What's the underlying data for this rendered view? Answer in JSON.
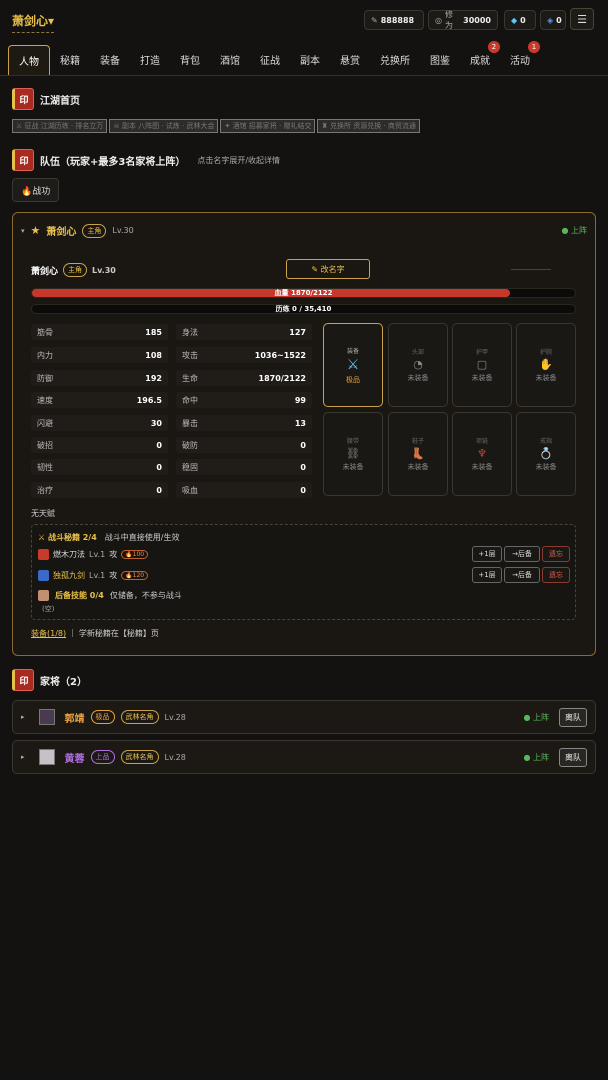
{
  "header": {
    "char_name": "萧剑心▾",
    "currency": {
      "icon": "coin-icon",
      "value": "888888"
    },
    "cultivation": {
      "label": "修为",
      "value": "30000"
    },
    "diamond": {
      "value": "0"
    },
    "gem": {
      "value": "0"
    },
    "menu_icon": "☰"
  },
  "tabs": [
    {
      "label": "人物",
      "active": true
    },
    {
      "label": "秘籍"
    },
    {
      "label": "装备"
    },
    {
      "label": "打造"
    },
    {
      "label": "背包"
    },
    {
      "label": "酒馆"
    },
    {
      "label": "征战"
    },
    {
      "label": "副本"
    },
    {
      "label": "悬赏"
    },
    {
      "label": "兑换所"
    },
    {
      "label": "图鉴"
    },
    {
      "label": "成就",
      "badge": "2"
    },
    {
      "label": "活动",
      "badge": "1"
    }
  ],
  "home": {
    "seal": "印",
    "title": "江湖首页",
    "links": [
      "⚔ 征战 江湖历练 · 排名立万",
      "☠ 副本 八阵图 · 试炼 · 武林大会",
      "✦ 酒馆 招募家将 · 赠礼结交",
      "♜ 兑换所 资源兑换 · 商贸流通"
    ]
  },
  "team": {
    "seal": "印",
    "title": "队伍（玩家+最多3名家将上阵）",
    "hint": "点击名字展开/收起详情",
    "battle_power": "🔥战功"
  },
  "hero": {
    "star": "★",
    "name": "萧剑心",
    "role": "主角",
    "level": "Lv.30",
    "status": "● 上阵",
    "rename": "✎ 改名字",
    "hp_label": "血量 1870/2122",
    "hp_fraction": 0.881,
    "exp_label": "历练 0 / 35,410",
    "exp_fraction": 0,
    "stats_left": [
      {
        "k": "筋骨",
        "v": "185"
      },
      {
        "k": "内力",
        "v": "108"
      },
      {
        "k": "防御",
        "v": "192"
      },
      {
        "k": "速度",
        "v": "196.5"
      },
      {
        "k": "闪避",
        "v": "30"
      },
      {
        "k": "破招",
        "v": "0"
      },
      {
        "k": "韧性",
        "v": "0"
      },
      {
        "k": "治疗",
        "v": "0"
      }
    ],
    "stats_right": [
      {
        "k": "身法",
        "v": "127"
      },
      {
        "k": "攻击",
        "v": "1036~1522"
      },
      {
        "k": "生命",
        "v": "1870/2122"
      },
      {
        "k": "命中",
        "v": "99"
      },
      {
        "k": "暴击",
        "v": "13"
      },
      {
        "k": "破防",
        "v": "0"
      },
      {
        "k": "稳固",
        "v": "0"
      },
      {
        "k": "吸血",
        "v": "0"
      }
    ],
    "slots": [
      {
        "label": "装备",
        "icon": "⚔",
        "text": "极品",
        "equipped": true
      },
      {
        "label": "头部",
        "icon": "◔",
        "text": "未装备"
      },
      {
        "label": "护甲",
        "icon": "▢",
        "text": "未装备"
      },
      {
        "label": "护腕",
        "icon": "✋",
        "text": "未装备"
      },
      {
        "label": "腰带",
        "icon": "⛓",
        "text": "未装备"
      },
      {
        "label": "鞋子",
        "icon": "👢",
        "text": "未装备"
      },
      {
        "label": "项链",
        "icon": "♆",
        "text": "未装备"
      },
      {
        "label": "戒指",
        "icon": "💍",
        "text": "未装备"
      }
    ],
    "talent": "无天赋",
    "combat_title": "⚔ 战斗秘籍 2/4",
    "combat_hint": "战斗中直接使用/生效",
    "skills": [
      {
        "name": "燃木刀法",
        "level": "Lv.1",
        "type": "攻",
        "cost": "🔥100",
        "btn1": "+1层",
        "btn2": "→后备",
        "btn3": "遗忘"
      },
      {
        "name": "独孤九剑",
        "level": "Lv.1",
        "type": "攻",
        "cost": "🔥120",
        "btn1": "+1层",
        "btn2": "→后备",
        "btn3": "遗忘"
      }
    ],
    "reserve_title": "后备技能 0/4",
    "reserve_hint": "仅储备，不参与战斗",
    "reserve_empty": "(空)",
    "footer_link": "装备(1/8)",
    "footer_sep": "|",
    "footer_text": "学新秘籍在【秘籍】页"
  },
  "retainers": {
    "seal": "印",
    "title": "家将（2）",
    "list": [
      {
        "name": "郭靖",
        "grade": "极品",
        "tag": "武林名角",
        "level": "Lv.28",
        "status": "● 上阵",
        "action": "离队",
        "color": "#e8a040"
      },
      {
        "name": "黄蓉",
        "grade": "上品",
        "tag": "武林名角",
        "level": "Lv.28",
        "status": "● 上阵",
        "action": "离队",
        "color": "#b070e0"
      }
    ]
  },
  "colors": {
    "accent": "#c9a24a",
    "gold": "#e8c04a",
    "hp": "#d8453a",
    "green": "#5ab85a"
  }
}
